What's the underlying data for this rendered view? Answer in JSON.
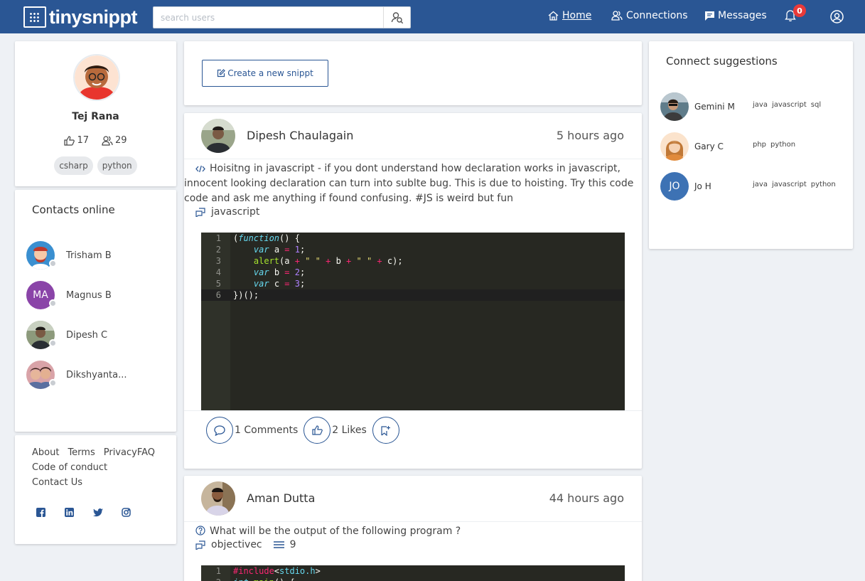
{
  "header": {
    "logo_text": "tinysnippt",
    "search_placeholder": "search users",
    "nav": {
      "home": "Home",
      "connections": "Connections",
      "messages": "Messages"
    },
    "notification_count": "0",
    "brand_color": "#2a5694"
  },
  "profile": {
    "name": "Tej Rana",
    "likes": "17",
    "connections": "29",
    "tags": [
      "csharp",
      "python"
    ]
  },
  "contacts": {
    "title": "Contacts online",
    "items": [
      {
        "name": "Trisham B"
      },
      {
        "name": "Magnus B",
        "initials": "MA"
      },
      {
        "name": "Dipesh C"
      },
      {
        "name": "Dikshyanta..."
      }
    ]
  },
  "footer": {
    "links": [
      "About",
      "Terms",
      "Privacy",
      "FAQ",
      "Code of conduct",
      "Contact Us"
    ],
    "social": [
      "facebook-icon",
      "linkedin-icon",
      "twitter-icon",
      "instagram-icon"
    ]
  },
  "create": {
    "label": "Create a new snippt"
  },
  "posts": [
    {
      "author": "Dipesh Chaulagain",
      "time": "5 hours ago",
      "text": "Hoisitng in javascript - if you dont understand how declaration works in javascript, innocent looking declaration can turn into sublte bug. This is due to hoisting. Try this code code and ask me anything if found confusing. #JS is weird but fun",
      "language": "javascript",
      "code_lines": [
        "(function() {",
        "    var a = 1;",
        "    alert(a + \" \" + b + \" \" + c);",
        "    var b = 2;",
        "    var c = 3;",
        "})();"
      ],
      "comments": "1 Comments",
      "likes": "2 Likes"
    },
    {
      "author": "Aman Dutta",
      "time": "44 hours ago",
      "text": "What will be the output of the following program ?",
      "language": "objectivec",
      "options_count": "9",
      "code_lines": [
        "#include<stdio.h>",
        "int main() {"
      ]
    }
  ],
  "suggestions": {
    "title": "Connect suggestions",
    "items": [
      {
        "name": "Gemini M",
        "skills": [
          "java",
          "javascript",
          "sql"
        ]
      },
      {
        "name": "Gary C",
        "skills": [
          "php",
          "python"
        ]
      },
      {
        "name": "Jo H",
        "initials": "JO",
        "skills": [
          "java",
          "javascript",
          "python"
        ]
      }
    ]
  }
}
